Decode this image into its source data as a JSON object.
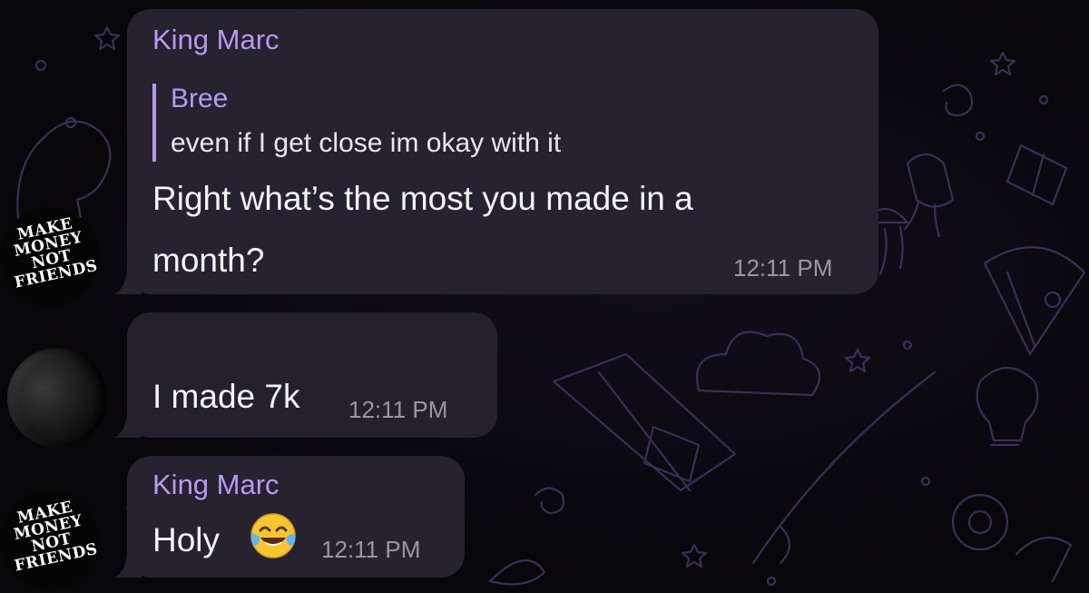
{
  "messages": [
    {
      "sender": "King Marc",
      "reply": {
        "author": "Bree",
        "text": "even if I get close im okay with it"
      },
      "text_line1": "Right what’s the most you made in a",
      "text_line2": "month?",
      "time": "12:11 PM"
    },
    {
      "sender_redacted": true,
      "text": "I made 7k",
      "time": "12:11 PM"
    },
    {
      "sender": "King Marc",
      "text": "Holy",
      "emoji": "face-with-tears-of-joy",
      "time": "12:11 PM"
    }
  ],
  "avatars": {
    "king_marc_logo_lines": [
      "MAKE",
      "MONEY",
      "NOT",
      "FRIENDS"
    ]
  },
  "colors": {
    "background": "#07060a",
    "bubble": "#262230",
    "sender_name": "#b89af0",
    "quote_bar": "#b49ae8",
    "timestamp": "#9a96a3",
    "doodles": "#3a2f56"
  }
}
